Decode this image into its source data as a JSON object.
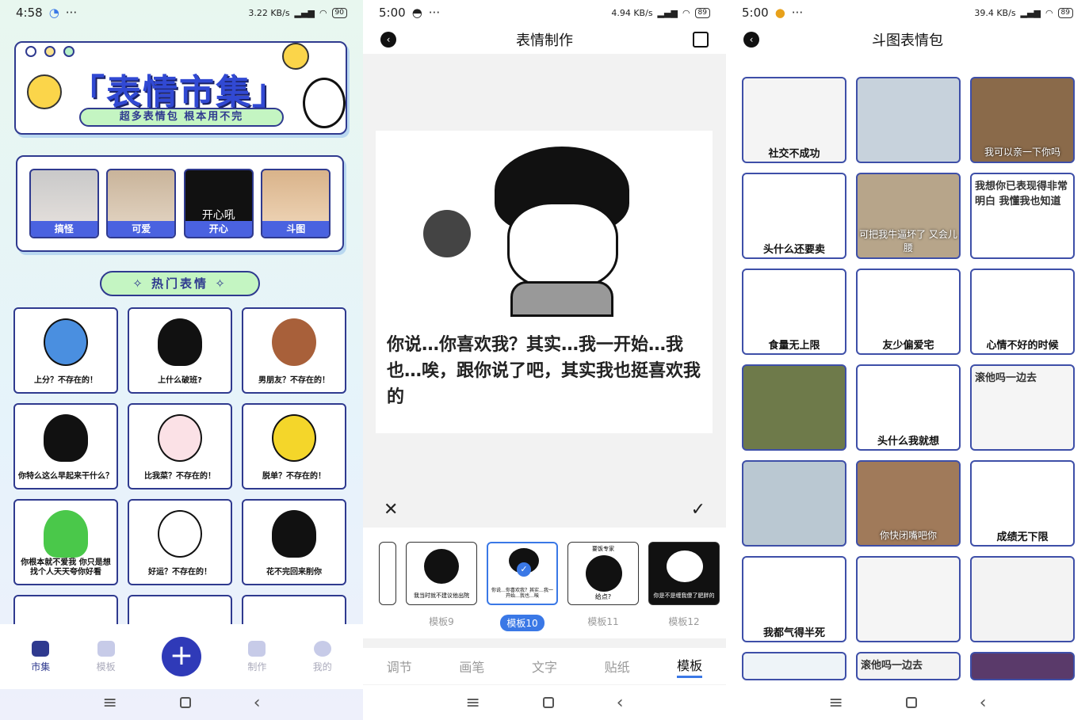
{
  "status_bars": [
    {
      "time": "4:58",
      "speed": "3.22 KB/s",
      "battery": "90"
    },
    {
      "time": "5:00",
      "speed": "4.94 KB/s",
      "battery": "89"
    },
    {
      "time": "5:00",
      "speed": "39.4 KB/s",
      "battery": "89"
    }
  ],
  "market": {
    "hero_title": "「表情市集」",
    "hero_sub": "超多表情包 根本用不完",
    "categories": [
      "搞怪",
      "可爱",
      "开心",
      "斗图"
    ],
    "category_overlay": "开心吼",
    "hot_label": "✧ 热门表情 ✧",
    "memes": [
      "上分？不存在的！",
      "上什么破班?",
      "男朋友？不存在的！",
      "你特么这么早起来干什么？",
      "比我菜？不存在的！",
      "脱单？不存在的！",
      "你根本就不爱我 你只是想找个人天天夸你好看",
      "好运？不存在的！",
      "花不完回来削你"
    ],
    "tabs": [
      {
        "label": "市集",
        "active": true
      },
      {
        "label": "模板",
        "active": false
      },
      {
        "label": "+",
        "active": false
      },
      {
        "label": "制作",
        "active": false
      },
      {
        "label": "我的",
        "active": false
      }
    ]
  },
  "maker": {
    "title": "表情制作",
    "canvas_text": "你说…你喜欢我？其实…我一开始…我也…唉，跟你说了吧，其实我也挺喜欢我的",
    "cancel": "✕",
    "confirm": "✓",
    "templates": [
      {
        "name": "",
        "caption": "",
        "selected": false
      },
      {
        "name": "模板9",
        "caption": "我当时就不建议他出院",
        "selected": false
      },
      {
        "name": "模板10",
        "caption": "你说…你喜欢我？其实…我一开始…我也…唉",
        "selected": true
      },
      {
        "name": "模板11",
        "caption": "给点?",
        "selected": false
      },
      {
        "name": "模板12",
        "caption": "你是不是缠我傻了肥胖的",
        "selected": false
      }
    ],
    "template11_top": "要饭专家",
    "tool_tabs": [
      {
        "label": "调节",
        "active": false
      },
      {
        "label": "画笔",
        "active": false
      },
      {
        "label": "文字",
        "active": false
      },
      {
        "label": "贴纸",
        "active": false
      },
      {
        "label": "模板",
        "active": true
      }
    ]
  },
  "gallery": {
    "title": "斗图表情包",
    "items": [
      {
        "cap": "社交不成功",
        "style": "cap"
      },
      {
        "cap": "",
        "style": "none"
      },
      {
        "cap": "我可以亲一下你吗",
        "style": "capw"
      },
      {
        "cap": "头什么还要卖",
        "style": "cap"
      },
      {
        "cap": "可把我牛逼坏了 又会儿腰",
        "style": "capw"
      },
      {
        "cap": "我想你已表现得非常明白 我懂我也知道",
        "style": "capt"
      },
      {
        "cap": "食量无上限",
        "style": "cap"
      },
      {
        "cap": "友少偏爱宅",
        "style": "cap"
      },
      {
        "cap": "心情不好的时候",
        "style": "cap"
      },
      {
        "cap": "",
        "style": "none"
      },
      {
        "cap": "头什么我就想",
        "style": "cap"
      },
      {
        "cap": "滚他吗一边去",
        "style": "capt"
      },
      {
        "cap": "",
        "style": "none"
      },
      {
        "cap": "你快闭嘴吧你",
        "style": "capw"
      },
      {
        "cap": "成绩无下限",
        "style": "cap"
      },
      {
        "cap": "我都气得半死",
        "style": "cap"
      },
      {
        "cap": "",
        "style": "none"
      },
      {
        "cap": "",
        "style": "none"
      },
      {
        "cap": "",
        "style": "none"
      },
      {
        "cap": "滚他吗一边去",
        "style": "capt"
      },
      {
        "cap": "",
        "style": "none"
      }
    ]
  },
  "colors": {
    "brand": "#2f3a8f",
    "accent": "#3a78e6",
    "green": "#c4f5c2"
  }
}
